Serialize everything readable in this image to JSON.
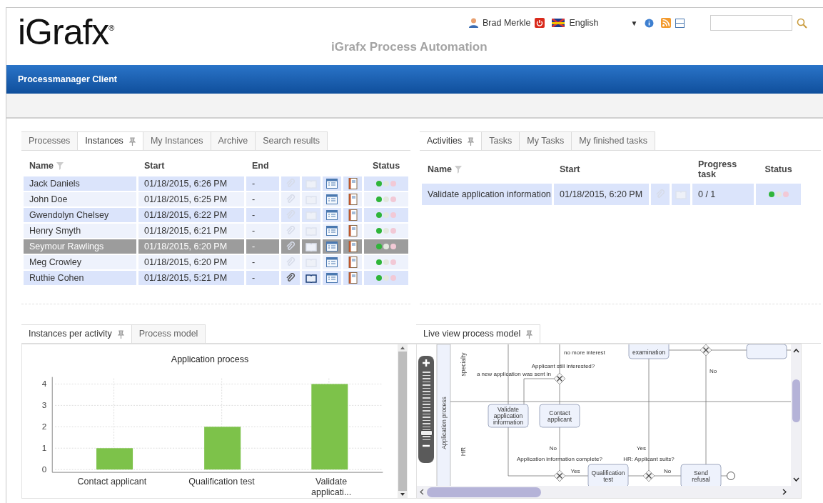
{
  "header": {
    "logo": "iGrafx",
    "logo_mark": "®",
    "product": "iGrafx Process Automation",
    "user": "Brad Merkle",
    "language": "English",
    "language_caret": "▼"
  },
  "nav_bar": {
    "title": "Processmanager Client"
  },
  "instances_panel": {
    "tabs": [
      {
        "label": "Processes",
        "selected": false,
        "pinned": false
      },
      {
        "label": "Instances",
        "selected": true,
        "pinned": true
      },
      {
        "label": "My Instances",
        "selected": false,
        "pinned": false
      },
      {
        "label": "Archive",
        "selected": false,
        "pinned": false
      },
      {
        "label": "Search results",
        "selected": false,
        "pinned": false
      }
    ],
    "columns": [
      "Name",
      "Start",
      "End",
      "Status"
    ],
    "rows": [
      {
        "name": "Jack Daniels",
        "start": "01/18/2015, 6:26 PM",
        "end": "-",
        "attachment": false,
        "document": false,
        "selected": false
      },
      {
        "name": "John Doe",
        "start": "01/18/2015, 6:25 PM",
        "end": "-",
        "attachment": false,
        "document": false,
        "selected": false
      },
      {
        "name": "Gwendolyn Chelsey",
        "start": "01/18/2015, 6:22 PM",
        "end": "-",
        "attachment": false,
        "document": false,
        "selected": false
      },
      {
        "name": "Henry Smyth",
        "start": "01/18/2015, 6:21 PM",
        "end": "-",
        "attachment": false,
        "document": false,
        "selected": false
      },
      {
        "name": "Seymour Rawlings",
        "start": "01/18/2015, 6:20 PM",
        "end": "-",
        "attachment": false,
        "document": false,
        "selected": true
      },
      {
        "name": "Meg Crowley",
        "start": "01/18/2015, 6:20 PM",
        "end": "-",
        "attachment": false,
        "document": false,
        "selected": false
      },
      {
        "name": "Ruthie Cohen",
        "start": "01/18/2015, 5:21 PM",
        "end": "-",
        "attachment": true,
        "document": true,
        "selected": false
      }
    ]
  },
  "activities_panel": {
    "tabs": [
      {
        "label": "Activities",
        "selected": true,
        "pinned": true
      },
      {
        "label": "Tasks",
        "selected": false,
        "pinned": false
      },
      {
        "label": "My Tasks",
        "selected": false,
        "pinned": false
      },
      {
        "label": "My finished tasks",
        "selected": false,
        "pinned": false
      }
    ],
    "columns": [
      "Name",
      "Start",
      "Progress task",
      "Status"
    ],
    "rows": [
      {
        "name": "Validate application information",
        "start": "01/18/2015, 6:20 PM",
        "progress": "0 / 1",
        "attachment": false,
        "document": false,
        "selected": false
      }
    ]
  },
  "chart_panel": {
    "tabs": [
      {
        "label": "Instances per activity",
        "selected": true,
        "pinned": true
      },
      {
        "label": "Process model",
        "selected": false,
        "pinned": false
      }
    ],
    "chart_data": {
      "type": "bar",
      "title": "Application process",
      "categories": [
        "Contact applicant",
        "Qualification test",
        "Validate applicati..."
      ],
      "series": [
        {
          "color": "#7dc24a",
          "values": [
            1,
            2,
            4
          ]
        }
      ],
      "ylim": [
        0,
        4
      ],
      "yticks": [
        0,
        1,
        2,
        3,
        4
      ],
      "grid": true
    }
  },
  "live_view_panel": {
    "tabs": [
      {
        "label": "Live view process model",
        "selected": true,
        "pinned": true
      }
    ],
    "lanes": [
      "Application process",
      "specialty",
      "HR"
    ],
    "tasks": [
      "Validate application information",
      "Contact applicant",
      "Qualification test",
      "Send refusal",
      "examination"
    ],
    "flow_labels": [
      "Applicant still interested?",
      "a new application was sent in",
      "no more interest",
      "Application information complete?",
      "HR: Applicant suits?",
      "Yes",
      "No",
      "No",
      "Yes",
      "No"
    ]
  }
}
